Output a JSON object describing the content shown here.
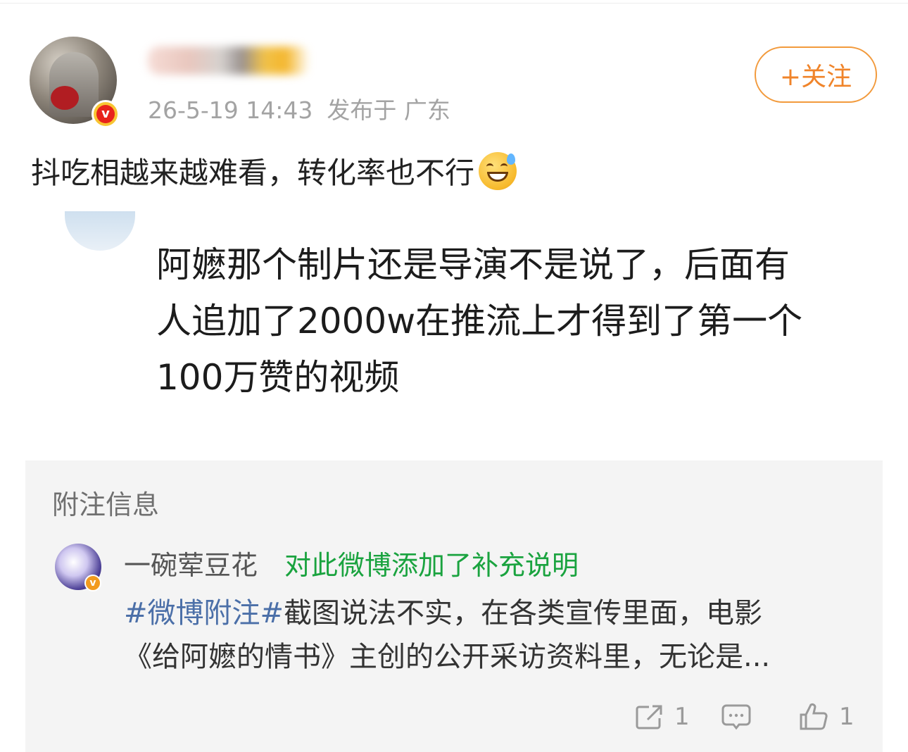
{
  "post": {
    "timestamp": "26-5-19 14:43",
    "location": "发布于 广东",
    "follow_label": "+关注",
    "text": "抖吃相越来越难看，转化率也不行"
  },
  "quote": {
    "lines": [
      "阿嬷那个制片还是导演不是说了，后面有",
      "人追加了2000w在推流上才得到了第一个",
      "100万赞的视频"
    ]
  },
  "note": {
    "title": "附注信息",
    "author": "一碗荤豆花",
    "action": "对此微博添加了补充说明",
    "hashtag": "#微博附注#",
    "line1_rest": "截图说法不实，在各类宣传里面，电影",
    "line2": "《给阿嬷的情书》主创的公开采访资料里，无论是..."
  },
  "actions": {
    "share_count": "1",
    "like_count": "1"
  },
  "icons": {
    "verified": "verified-badge-icon",
    "emoji": "sweat-smile-emoji-icon",
    "share": "share-icon",
    "comment": "comment-icon",
    "like": "thumbs-up-icon"
  },
  "colors": {
    "follow": "#f0842a",
    "note_action": "#1aa33f",
    "hashtag": "#4b6fa8",
    "meta": "#a3a3a3"
  }
}
